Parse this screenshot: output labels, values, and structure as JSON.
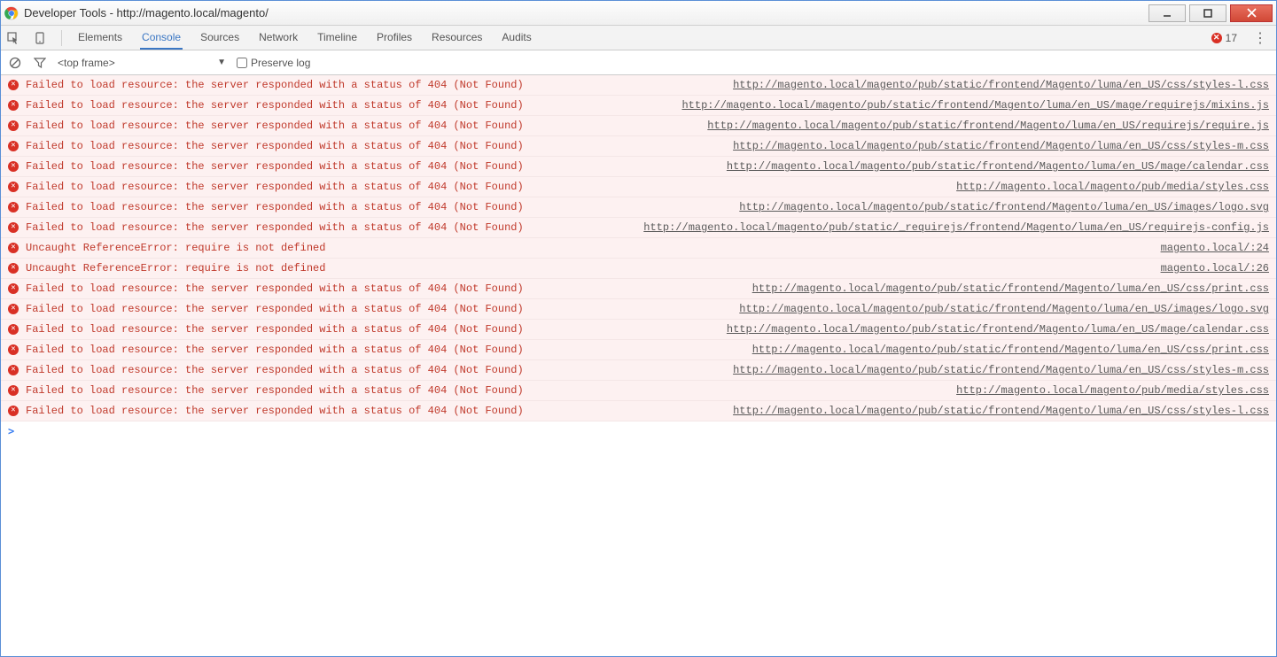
{
  "window": {
    "title": "Developer Tools - http://magento.local/magento/"
  },
  "tabs": {
    "items": [
      "Elements",
      "Console",
      "Sources",
      "Network",
      "Timeline",
      "Profiles",
      "Resources",
      "Audits"
    ],
    "active_index": 1
  },
  "error_badge": {
    "count": "17"
  },
  "filter": {
    "frame_label": "<top frame>",
    "preserve_label": "Preserve log",
    "preserve_checked": false
  },
  "msg404": "Failed to load resource: the server responded with a status of 404 (Not Found)",
  "msgRef": "Uncaught ReferenceError: require is not defined",
  "logs": [
    {
      "type": "404",
      "src": "http://magento.local/magento/pub/static/frontend/Magento/luma/en_US/css/styles-l.css"
    },
    {
      "type": "404",
      "src": "http://magento.local/magento/pub/static/frontend/Magento/luma/en_US/mage/requirejs/mixins.js"
    },
    {
      "type": "404",
      "src": "http://magento.local/magento/pub/static/frontend/Magento/luma/en_US/requirejs/require.js"
    },
    {
      "type": "404",
      "src": "http://magento.local/magento/pub/static/frontend/Magento/luma/en_US/css/styles-m.css"
    },
    {
      "type": "404",
      "src": "http://magento.local/magento/pub/static/frontend/Magento/luma/en_US/mage/calendar.css"
    },
    {
      "type": "404",
      "src": "http://magento.local/magento/pub/media/styles.css"
    },
    {
      "type": "404",
      "src": "http://magento.local/magento/pub/static/frontend/Magento/luma/en_US/images/logo.svg"
    },
    {
      "type": "404",
      "src": "http://magento.local/magento/pub/static/_requirejs/frontend/Magento/luma/en_US/requirejs-config.js"
    },
    {
      "type": "ref",
      "src": "magento.local/:24"
    },
    {
      "type": "ref",
      "src": "magento.local/:26"
    },
    {
      "type": "404",
      "src": "http://magento.local/magento/pub/static/frontend/Magento/luma/en_US/css/print.css"
    },
    {
      "type": "404",
      "src": "http://magento.local/magento/pub/static/frontend/Magento/luma/en_US/images/logo.svg"
    },
    {
      "type": "404",
      "src": "http://magento.local/magento/pub/static/frontend/Magento/luma/en_US/mage/calendar.css"
    },
    {
      "type": "404",
      "src": "http://magento.local/magento/pub/static/frontend/Magento/luma/en_US/css/print.css"
    },
    {
      "type": "404",
      "src": "http://magento.local/magento/pub/static/frontend/Magento/luma/en_US/css/styles-m.css"
    },
    {
      "type": "404",
      "src": "http://magento.local/magento/pub/media/styles.css"
    },
    {
      "type": "404",
      "src": "http://magento.local/magento/pub/static/frontend/Magento/luma/en_US/css/styles-l.css"
    }
  ],
  "prompt": ">"
}
